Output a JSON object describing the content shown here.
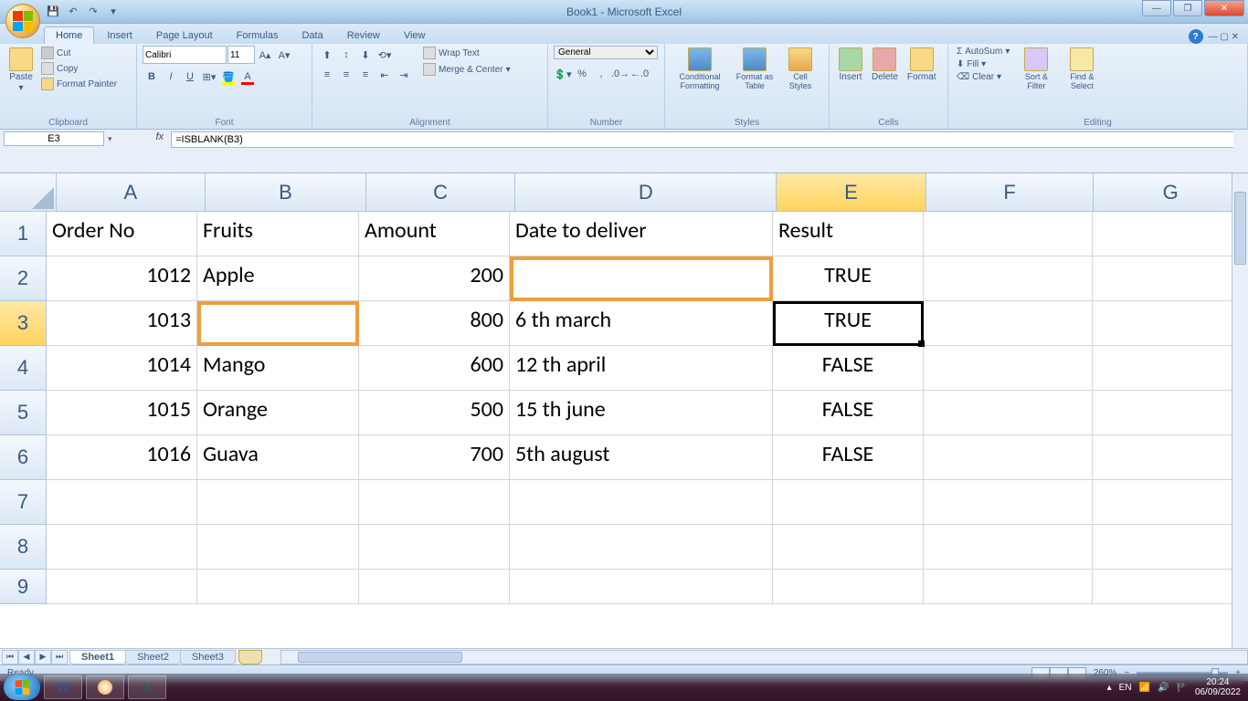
{
  "window": {
    "title": "Book1 - Microsoft Excel"
  },
  "qat": {
    "save": "💾",
    "undo": "↶",
    "redo": "↷"
  },
  "tabs": [
    "Home",
    "Insert",
    "Page Layout",
    "Formulas",
    "Data",
    "Review",
    "View"
  ],
  "ribbon": {
    "clipboard": {
      "label": "Clipboard",
      "paste": "Paste",
      "cut": "Cut",
      "copy": "Copy",
      "painter": "Format Painter"
    },
    "font": {
      "label": "Font",
      "name": "Calibri",
      "size": "11",
      "bold": "B",
      "italic": "I",
      "underline": "U"
    },
    "alignment": {
      "label": "Alignment",
      "wrap": "Wrap Text",
      "merge": "Merge & Center"
    },
    "number": {
      "label": "Number",
      "format": "General"
    },
    "styles": {
      "label": "Styles",
      "cond": "Conditional Formatting",
      "table": "Format as Table",
      "cell": "Cell Styles"
    },
    "cells": {
      "label": "Cells",
      "insert": "Insert",
      "delete": "Delete",
      "format": "Format"
    },
    "editing": {
      "label": "Editing",
      "autosum": "AutoSum",
      "fill": "Fill",
      "clear": "Clear",
      "sort": "Sort & Filter",
      "find": "Find & Select"
    }
  },
  "formula_bar": {
    "cell_ref": "E3",
    "fx": "fx",
    "formula": "=ISBLANK(B3)"
  },
  "columns": [
    "A",
    "B",
    "C",
    "D",
    "E",
    "F",
    "G"
  ],
  "rows": [
    "1",
    "2",
    "3",
    "4",
    "5",
    "6",
    "7",
    "8",
    "9"
  ],
  "data": {
    "r1": {
      "A": "Order No",
      "B": "Fruits",
      "C": "Amount",
      "D": "Date to deliver",
      "E": "Result"
    },
    "r2": {
      "A": "1012",
      "B": "Apple",
      "C": "200",
      "D": "",
      "E": "TRUE"
    },
    "r3": {
      "A": "1013",
      "B": "",
      "C": "800",
      "D": "6 th march",
      "E": "TRUE"
    },
    "r4": {
      "A": "1014",
      "B": "Mango",
      "C": "600",
      "D": "12 th april",
      "E": "FALSE"
    },
    "r5": {
      "A": "1015",
      "B": "Orange",
      "C": "500",
      "D": "15 th june",
      "E": "FALSE"
    },
    "r6": {
      "A": "1016",
      "B": "Guava",
      "C": "700",
      "D": "5th august",
      "E": "FALSE"
    }
  },
  "sheets": [
    "Sheet1",
    "Sheet2",
    "Sheet3"
  ],
  "status": {
    "ready": "Ready",
    "zoom": "260%"
  },
  "taskbar": {
    "lang": "EN",
    "time": "20:24",
    "date": "06/09/2022"
  }
}
